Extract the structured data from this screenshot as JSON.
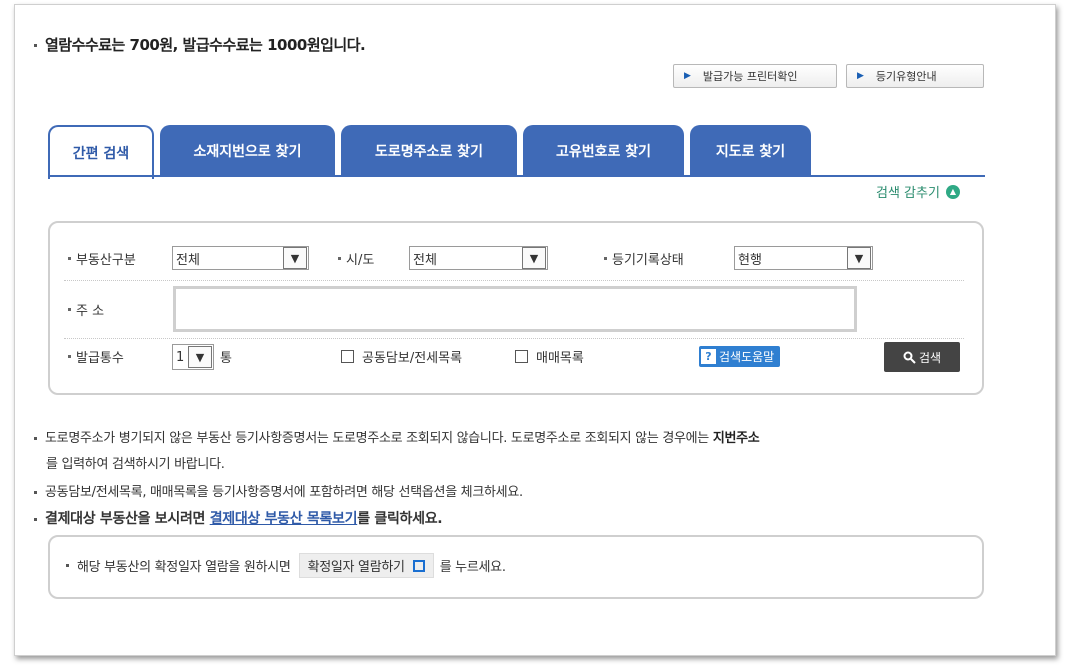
{
  "fee_notice": "열람수수료는 700원, 발급수수료는 1000원입니다.",
  "top_buttons": {
    "printer_check": "발급가능 프린터확인",
    "registry_type": "등기유형안내"
  },
  "tabs": [
    "간편 검색",
    "소재지번으로 찾기",
    "도로명주소로 찾기",
    "고유번호로 찾기",
    "지도로 찾기"
  ],
  "collapse_label": "검색 감추기",
  "form": {
    "property_type_label": "부동산구분",
    "property_type_value": "전체",
    "city_label": "시/도",
    "city_value": "전체",
    "record_status_label": "등기기록상태",
    "record_status_value": "현행",
    "address_label": "주 소",
    "address_value": "",
    "copies_label": "발급통수",
    "copies_value": "1",
    "copies_unit": "통",
    "collateral_label": "공동담보/전세목록",
    "sale_label": "매매목록",
    "help_label": "검색도움말",
    "search_label": "검색"
  },
  "notes": {
    "note1_text": "도로명주소가 병기되지 않은 부동산 등기사항증명서는 도로명주소로 조회되지 않습니다. 도로명주소로 조회되지 않는 경우에는 ",
    "note1_bold": "지번주소",
    "note1_cont": "를 입력하여 검색하시기 바랍니다.",
    "note2": "공동담보/전세목록, 매매목록을 등기사항증명서에 포함하려면 해당 선택옵션을 체크하세요.",
    "note3_pre": "결제대상 부동산을 보시려면 ",
    "note3_link": "결제대상 부동산 목록보기",
    "note3_post": "를 클릭하세요."
  },
  "bottom": {
    "pre": "해당 부동산의 확정일자 열람을 원하시면",
    "button": "확정일자 열람하기",
    "post": "를 누르세요."
  },
  "icons": {
    "ext_link": "external-link-icon",
    "search": "magnifier-icon",
    "help": "question-icon",
    "collapse": "chevron-up-icon"
  },
  "colors": {
    "tab_blue": "#3f6ab7",
    "green": "#2fa985",
    "help_blue": "#2f7fd1"
  }
}
